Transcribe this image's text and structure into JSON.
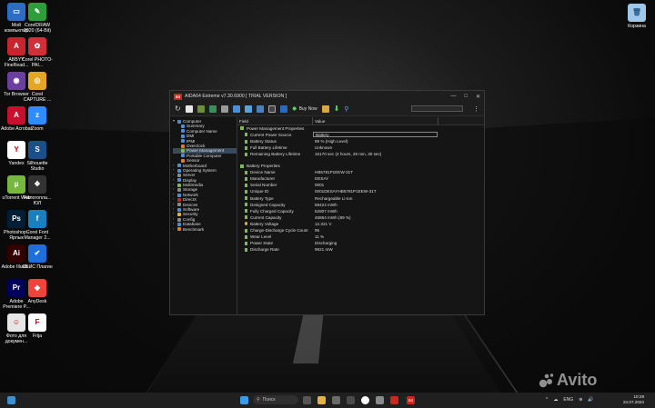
{
  "desktop": {
    "left_icons": [
      {
        "label": "Мой компьютер",
        "color": "#2b6cc4",
        "glyph": "▭",
        "icon": "computer-icon"
      },
      {
        "label": "CorelDRAW 2020 (64-Bit)",
        "color": "#2e9e3a",
        "glyph": "✎",
        "icon": "coreldraw-icon"
      },
      {
        "label": "ABBYY FineRead...",
        "color": "#c4262e",
        "glyph": "A",
        "icon": "abbyy-icon"
      },
      {
        "label": "Corel PHOTO-PAI...",
        "color": "#d0303a",
        "glyph": "✿",
        "icon": "corel-photopaint-icon"
      },
      {
        "label": "Tor Browser",
        "color": "#6b3fa0",
        "glyph": "◉",
        "icon": "tor-icon"
      },
      {
        "label": "Corel CAPTURE ...",
        "color": "#e5a623",
        "glyph": "◎",
        "icon": "corel-capture-icon"
      },
      {
        "label": "Adobe Acrobat",
        "color": "#c8102e",
        "glyph": "A",
        "icon": "acrobat-icon"
      },
      {
        "label": "Zoom",
        "color": "#2d8cff",
        "glyph": "z",
        "icon": "zoom-icon"
      },
      {
        "label": "Yandex",
        "color": "#ffffff",
        "glyph": "Y",
        "icon": "yandex-icon"
      },
      {
        "label": "Silhouette Studio",
        "color": "#1a4f8a",
        "glyph": "S",
        "icon": "silhouette-icon"
      },
      {
        "label": "uTorrent Web",
        "color": "#76b83f",
        "glyph": "µ",
        "icon": "utorrent-icon"
      },
      {
        "label": "Налогопла... ЮЛ",
        "color": "#333333",
        "glyph": "❖",
        "icon": "tax-icon"
      },
      {
        "label": "Photoshop - Ярлык",
        "color": "#001e36",
        "glyph": "Ps",
        "icon": "photoshop-icon"
      },
      {
        "label": "Corel Font Manager 2...",
        "color": "#1a7fbf",
        "glyph": "f",
        "icon": "corel-font-icon"
      },
      {
        "label": "Adobe Illustr...",
        "color": "#330000",
        "glyph": "Ai",
        "icon": "illustrator-icon"
      },
      {
        "label": "СБИС Плагин",
        "color": "#1e6fd9",
        "glyph": "✔",
        "icon": "sbis-icon"
      },
      {
        "label": "Adobe Premiere P...",
        "color": "#00005b",
        "glyph": "Pr",
        "icon": "premiere-icon"
      },
      {
        "label": "AnyDesk",
        "color": "#ef443b",
        "glyph": "◆",
        "icon": "anydesk-icon"
      },
      {
        "label": "Фото для докумен...",
        "color": "#e6e6e6",
        "glyph": "☺",
        "icon": "photo-doc-icon"
      },
      {
        "label": "Frija",
        "color": "#ffffff",
        "glyph": "F",
        "icon": "frija-icon"
      }
    ],
    "recycle_bin": {
      "label": "Корзина",
      "icon": "recycle-bin-icon"
    }
  },
  "window": {
    "badge": "64",
    "title": "AIDA64 Extreme v7.30.6900  [ TRIAL VERSION ]",
    "controls": {
      "minimize": "—",
      "maximize": "□",
      "close": "✕"
    },
    "toolbar": {
      "buy_now": "Buy Now",
      "menu": "⋮"
    },
    "tree": [
      {
        "label": "Computer",
        "level": 0,
        "arrow": "▾",
        "color": "#4a90d9"
      },
      {
        "label": "Summary",
        "level": 1,
        "arrow": "",
        "color": "#4a90d9"
      },
      {
        "label": "Computer Name",
        "level": 1,
        "arrow": "",
        "color": "#4a90d9"
      },
      {
        "label": "DMI",
        "level": 1,
        "arrow": "",
        "color": "#4a90d9"
      },
      {
        "label": "IPMI",
        "level": 1,
        "arrow": "",
        "color": "#4a90d9"
      },
      {
        "label": "Overclock",
        "level": 1,
        "arrow": "",
        "color": "#e07b28"
      },
      {
        "label": "Power Management",
        "level": 1,
        "arrow": "",
        "color": "#7bbd4d",
        "selected": true
      },
      {
        "label": "Portable Computer",
        "level": 1,
        "arrow": "",
        "color": "#4a90d9"
      },
      {
        "label": "Sensor",
        "level": 1,
        "arrow": "",
        "color": "#e07b28"
      },
      {
        "label": "Motherboard",
        "level": 0,
        "arrow": "›",
        "color": "#4a90d9"
      },
      {
        "label": "Operating System",
        "level": 0,
        "arrow": "›",
        "color": "#4a90d9"
      },
      {
        "label": "Server",
        "level": 0,
        "arrow": "›",
        "color": "#8a8a8a"
      },
      {
        "label": "Display",
        "level": 0,
        "arrow": "›",
        "color": "#4a90d9"
      },
      {
        "label": "Multimedia",
        "level": 0,
        "arrow": "›",
        "color": "#7bbd4d"
      },
      {
        "label": "Storage",
        "level": 0,
        "arrow": "›",
        "color": "#8a8a8a"
      },
      {
        "label": "Network",
        "level": 0,
        "arrow": "›",
        "color": "#4a90d9"
      },
      {
        "label": "DirectX",
        "level": 0,
        "arrow": "›",
        "color": "#c42b1c"
      },
      {
        "label": "Devices",
        "level": 0,
        "arrow": "›",
        "color": "#8a8a8a"
      },
      {
        "label": "Software",
        "level": 0,
        "arrow": "›",
        "color": "#4a90d9"
      },
      {
        "label": "Security",
        "level": 0,
        "arrow": "›",
        "color": "#e0b23a"
      },
      {
        "label": "Config",
        "level": 0,
        "arrow": "›",
        "color": "#8a8a8a"
      },
      {
        "label": "Database",
        "level": 0,
        "arrow": "›",
        "color": "#4a90d9"
      },
      {
        "label": "Benchmark",
        "level": 0,
        "arrow": "›",
        "color": "#e07b28"
      }
    ],
    "columns": {
      "field": "Field",
      "value": "Value"
    },
    "groups": [
      {
        "title": "Power Management Properties",
        "rows": [
          {
            "field": "Current Power Source",
            "value": "Battery",
            "highlight": true
          },
          {
            "field": "Battery Status",
            "value": "89 % (High Level)"
          },
          {
            "field": "Full Battery Lifetime",
            "value": "Unknown"
          },
          {
            "field": "Remaining Battery Lifetime",
            "value": "16170 sec (4 hours, 29 min, 30 sec)"
          }
        ]
      },
      {
        "title": "Battery Properties",
        "rows": [
          {
            "field": "Device Name",
            "value": "HB5781P1EEW-31T"
          },
          {
            "field": "Manufacturer",
            "value": "DESAY"
          },
          {
            "field": "Serial Number",
            "value": "0001"
          },
          {
            "field": "Unique ID",
            "value": "0001DESAYHB5781P1EEW-31T"
          },
          {
            "field": "Battery Type",
            "value": "Rechargeable Li-Ion"
          },
          {
            "field": "Designed Capacity",
            "value": "59424 mWh"
          },
          {
            "field": "Fully Charged Capacity",
            "value": "52807 mWh"
          },
          {
            "field": "Current Capacity",
            "value": "46864 mWh  (89 %)"
          },
          {
            "field": "Battery Voltage",
            "value": "12.321 V",
            "warn": true
          },
          {
            "field": "Charge-Discharge Cycle Count",
            "value": "95"
          },
          {
            "field": "Wear Level",
            "value": "11 %"
          },
          {
            "field": "Power State",
            "value": "Discharging"
          },
          {
            "field": "Discharge Rate",
            "value": "9921 mW"
          }
        ]
      }
    ]
  },
  "taskbar": {
    "search_label": "Поиск",
    "time": "10:29",
    "date": "24.07.2024",
    "tray": [
      "^",
      "☁",
      "ENG",
      "⊕",
      "🔊"
    ]
  },
  "watermark": "Avito"
}
